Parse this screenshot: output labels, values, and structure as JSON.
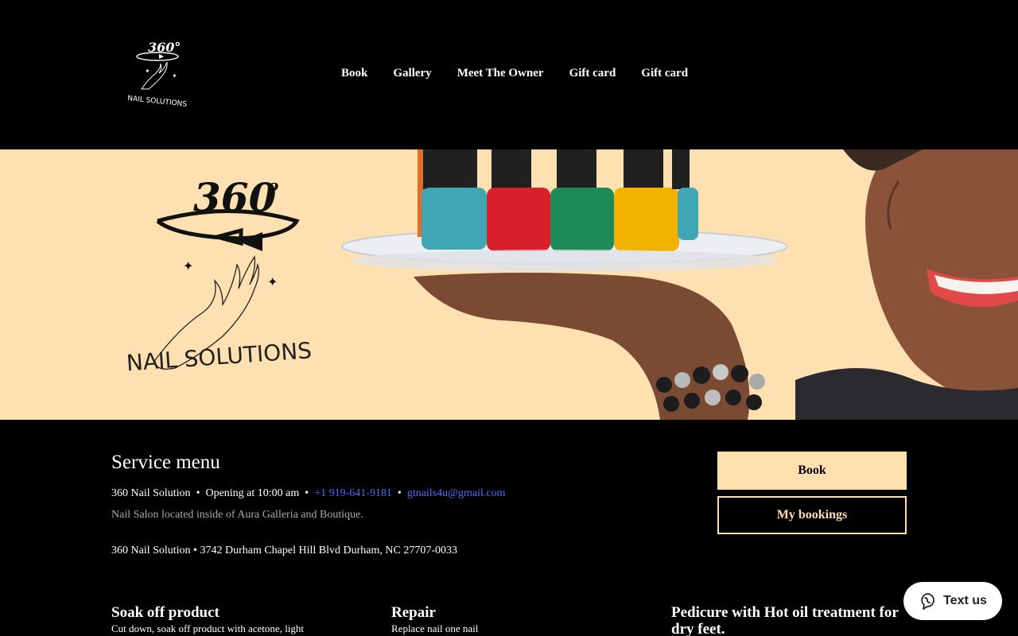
{
  "header": {
    "logo_text_top": "360°",
    "logo_text_bottom": "NAIL SOLUTIONS",
    "nav": [
      "Book",
      "Gallery",
      "Meet The Owner",
      "Gift card",
      "Gift card"
    ]
  },
  "hero": {
    "logo_number": "360",
    "logo_degree": "o",
    "logo_name": "NAIL SOLUTIONS",
    "polish_colors": [
      "#3fa7b4",
      "#d8202c",
      "#1f8a55",
      "#f2b300",
      "#3fa7b4"
    ],
    "background_color": "#ffe0b0"
  },
  "service": {
    "title": "Service menu",
    "business_name": "360 Nail Solution",
    "opening": "Opening at 10:00 am",
    "phone": "+1 919-641-9181",
    "email": "gtnails4u@gmail.com",
    "separator": "•",
    "description": "Nail Salon located inside of Aura Galleria and Boutique.",
    "address": "360 Nail Solution • 3742 Durham Chapel Hill Blvd Durham, NC 27707-0033",
    "book_button": "Book",
    "my_bookings_button": "My bookings",
    "cards": [
      {
        "title": "Soak off product",
        "desc": "Cut down, soak off product with acetone, light"
      },
      {
        "title": "Repair",
        "desc": "Replace nail one nail"
      },
      {
        "title": "Pedicure with Hot oil treatment for dry feet.",
        "desc": ""
      }
    ]
  },
  "widget": {
    "label": "Text us",
    "icon": "chat-icon"
  },
  "colors": {
    "accent": "#ffdfad",
    "link": "#4a6cff",
    "background": "#000000"
  }
}
